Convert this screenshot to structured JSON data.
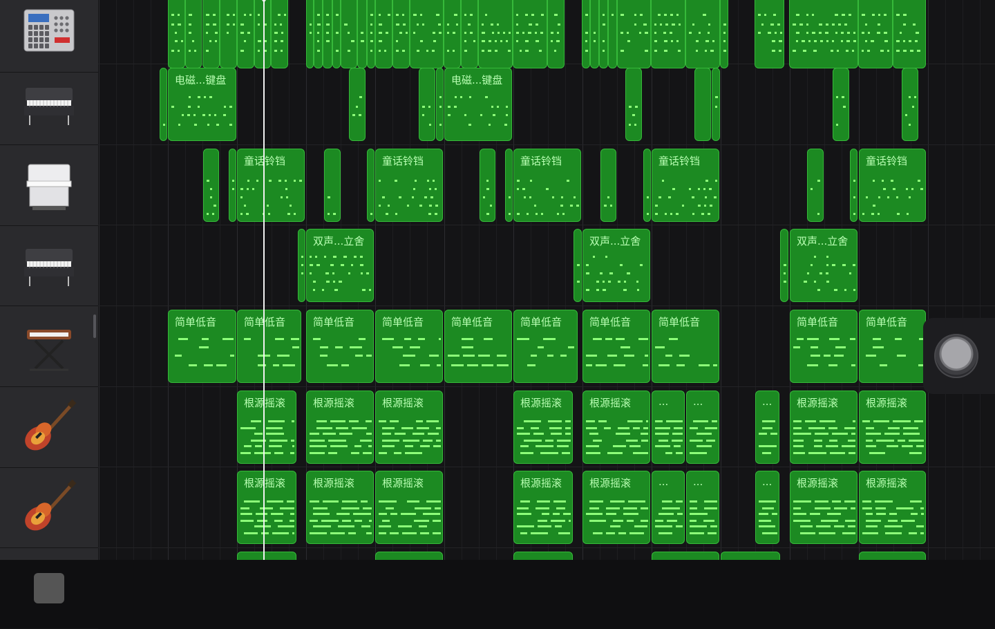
{
  "app": {
    "colors": {
      "region_fill": "#1c8a22",
      "region_border": "#36b93a",
      "note": "#8dff79",
      "label": "#b9ffb3",
      "playhead": "#f2f2f2"
    }
  },
  "tracks": [
    {
      "id": "drum-machine",
      "icon": "drum-machine-icon",
      "regions": [
        {
          "label": ""
        },
        {
          "label": ""
        },
        {
          "label": ""
        },
        {
          "label": ""
        },
        {
          "label": ""
        },
        {
          "label": ""
        },
        {
          "label": ""
        },
        {
          "label": ""
        },
        {
          "label": ""
        },
        {
          "label": ""
        },
        {
          "label": ""
        },
        {
          "label": ""
        },
        {
          "label": ""
        },
        {
          "label": ""
        },
        {
          "label": ""
        },
        {
          "label": ""
        },
        {
          "label": ""
        },
        {
          "label": ""
        },
        {
          "label": ""
        },
        {
          "label": ""
        },
        {
          "label": ""
        },
        {
          "label": ""
        },
        {
          "label": ""
        },
        {
          "label": ""
        },
        {
          "label": ""
        },
        {
          "label": ""
        },
        {
          "label": ""
        },
        {
          "label": ""
        },
        {
          "label": ""
        },
        {
          "label": ""
        },
        {
          "label": ""
        },
        {
          "label": ""
        },
        {
          "label": ""
        },
        {
          "label": ""
        }
      ]
    },
    {
      "id": "electric-piano",
      "icon": "electric-piano-icon",
      "regions": [
        {
          "label": ""
        },
        {
          "label": "电磁...键盘"
        },
        {
          "label": ""
        },
        {
          "label": ""
        },
        {
          "label": ""
        },
        {
          "label": "电磁...键盘"
        },
        {
          "label": ""
        },
        {
          "label": ""
        },
        {
          "label": ""
        },
        {
          "label": ""
        },
        {
          "label": ""
        }
      ]
    },
    {
      "id": "organ",
      "icon": "organ-icon",
      "regions": [
        {
          "label": ""
        },
        {
          "label": ""
        },
        {
          "label": "童话铃铛"
        },
        {
          "label": ""
        },
        {
          "label": ""
        },
        {
          "label": "童话铃铛"
        },
        {
          "label": ""
        },
        {
          "label": ""
        },
        {
          "label": "童话铃铛"
        },
        {
          "label": ""
        },
        {
          "label": ""
        },
        {
          "label": "童话铃铛"
        },
        {
          "label": ""
        },
        {
          "label": ""
        },
        {
          "label": "童话铃铛"
        }
      ]
    },
    {
      "id": "stage-piano",
      "icon": "stage-piano-icon",
      "regions": [
        {
          "label": ""
        },
        {
          "label": "双声...立舍"
        },
        {
          "label": ""
        },
        {
          "label": "双声...立舍"
        },
        {
          "label": ""
        },
        {
          "label": "双声...立舍"
        }
      ]
    },
    {
      "id": "synth-bass",
      "icon": "keyboard-stand-icon",
      "regions": [
        {
          "label": "简单低音"
        },
        {
          "label": "简单低音"
        },
        {
          "label": "简单低音"
        },
        {
          "label": "简单低音"
        },
        {
          "label": "简单低音"
        },
        {
          "label": "简单低音"
        },
        {
          "label": "简单低音"
        },
        {
          "label": "简单低音"
        },
        {
          "label": "简单低音"
        },
        {
          "label": "简单低音"
        }
      ]
    },
    {
      "id": "guitar-1",
      "icon": "electric-guitar-icon",
      "regions": [
        {
          "label": "根源摇滚"
        },
        {
          "label": "根源摇滚"
        },
        {
          "label": "根源摇滚"
        },
        {
          "label": "根源摇滚"
        },
        {
          "label": "根源摇滚"
        },
        {
          "label": "..."
        },
        {
          "label": "..."
        },
        {
          "label": "..."
        },
        {
          "label": "根源摇滚"
        },
        {
          "label": "根源摇滚"
        }
      ]
    },
    {
      "id": "guitar-2",
      "icon": "electric-guitar-icon",
      "regions": [
        {
          "label": "根源摇滚"
        },
        {
          "label": "根源摇滚"
        },
        {
          "label": "根源摇滚"
        },
        {
          "label": "根源摇滚"
        },
        {
          "label": "根源摇滚"
        },
        {
          "label": "..."
        },
        {
          "label": "..."
        },
        {
          "label": "..."
        },
        {
          "label": "根源摇滚"
        },
        {
          "label": "根源摇滚"
        }
      ]
    },
    {
      "id": "partial-track",
      "icon": "track-icon",
      "regions": [
        {
          "label": ""
        },
        {
          "label": ""
        },
        {
          "label": ""
        },
        {
          "label": ""
        },
        {
          "label": ""
        },
        {
          "label": ""
        },
        {
          "label": ""
        }
      ]
    }
  ]
}
